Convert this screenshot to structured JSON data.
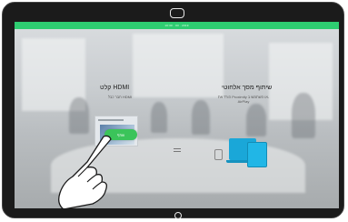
{
  "status_bar": {
    "text": "10:30 · 03 · 2019"
  },
  "hdmi_card": {
    "title": "קלט HDMI",
    "subtitle": "חבר כבל HDMI"
  },
  "wireless_card": {
    "title": "שיתוף מסך אלחוטי",
    "subtitle": "הורד את Proximity או השתמש ב-AirPlay"
  },
  "share_button": {
    "label": "שתף"
  },
  "icons": {
    "camera": "camera-icon",
    "home": "home-button-icon",
    "laptop": "laptop-icon",
    "tablet": "tablet-icon",
    "phone": "phone-icon",
    "hand": "hand-pointer-icon"
  },
  "colors": {
    "status_bar": "#2ecc71",
    "share_button": "#3bc45a",
    "device_icon": "#1aa7d8",
    "bezel": "#1b1b1b"
  }
}
